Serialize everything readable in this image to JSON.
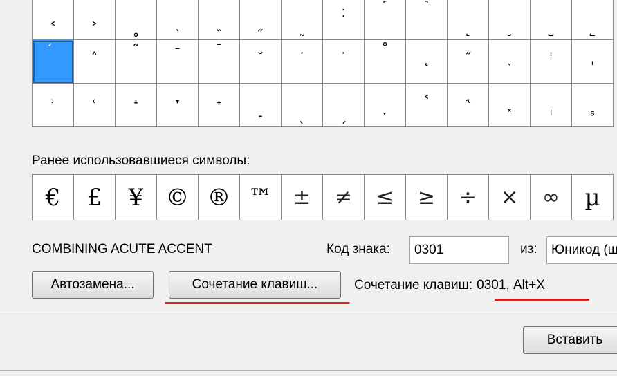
{
  "symbol_grid": {
    "rows": [
      [
        "˂",
        "˃",
        "˳",
        "˴",
        "˵",
        "˶",
        "˷",
        "˸",
        "˹",
        "˺",
        "˻",
        "˼",
        "˽",
        "˾"
      ],
      [
        "́",
        "˄",
        "˜",
        "ˉ",
        "ˉ",
        "˘",
        "˙",
        "˙",
        "˚",
        "˛",
        "˝",
        "˯",
        "ˈ",
        "ˌ"
      ],
      [
        "˒",
        "˓",
        "˔",
        "˕",
        "˖",
        "˗",
        "ˎ",
        "ˏ",
        "ˑ",
        "˂",
        "˞",
        "˟",
        "ˡ",
        "ˢ"
      ]
    ],
    "selected_symbol": "́"
  },
  "recent": {
    "label": "Ранее использовавшиеся символы:",
    "symbols": [
      "€",
      "£",
      "¥",
      "©",
      "®",
      "™",
      "±",
      "≠",
      "≤",
      "≥",
      "÷",
      "×",
      "∞",
      "µ"
    ]
  },
  "char_name": "COMBINING ACUTE ACCENT",
  "code": {
    "label": "Код знака:",
    "value": "0301"
  },
  "from": {
    "label": "из:",
    "value": "Юникод (ш"
  },
  "buttons": {
    "autocorrect": "Автозамена...",
    "shortcut": "Сочетание клавиш...",
    "insert": "Вставить"
  },
  "shortcut_info": {
    "label": "Сочетание клавиш:",
    "value": "0301, Alt+X"
  },
  "colors": {
    "selection": "#3399ff",
    "annotation_underline": "#d21f1f"
  }
}
